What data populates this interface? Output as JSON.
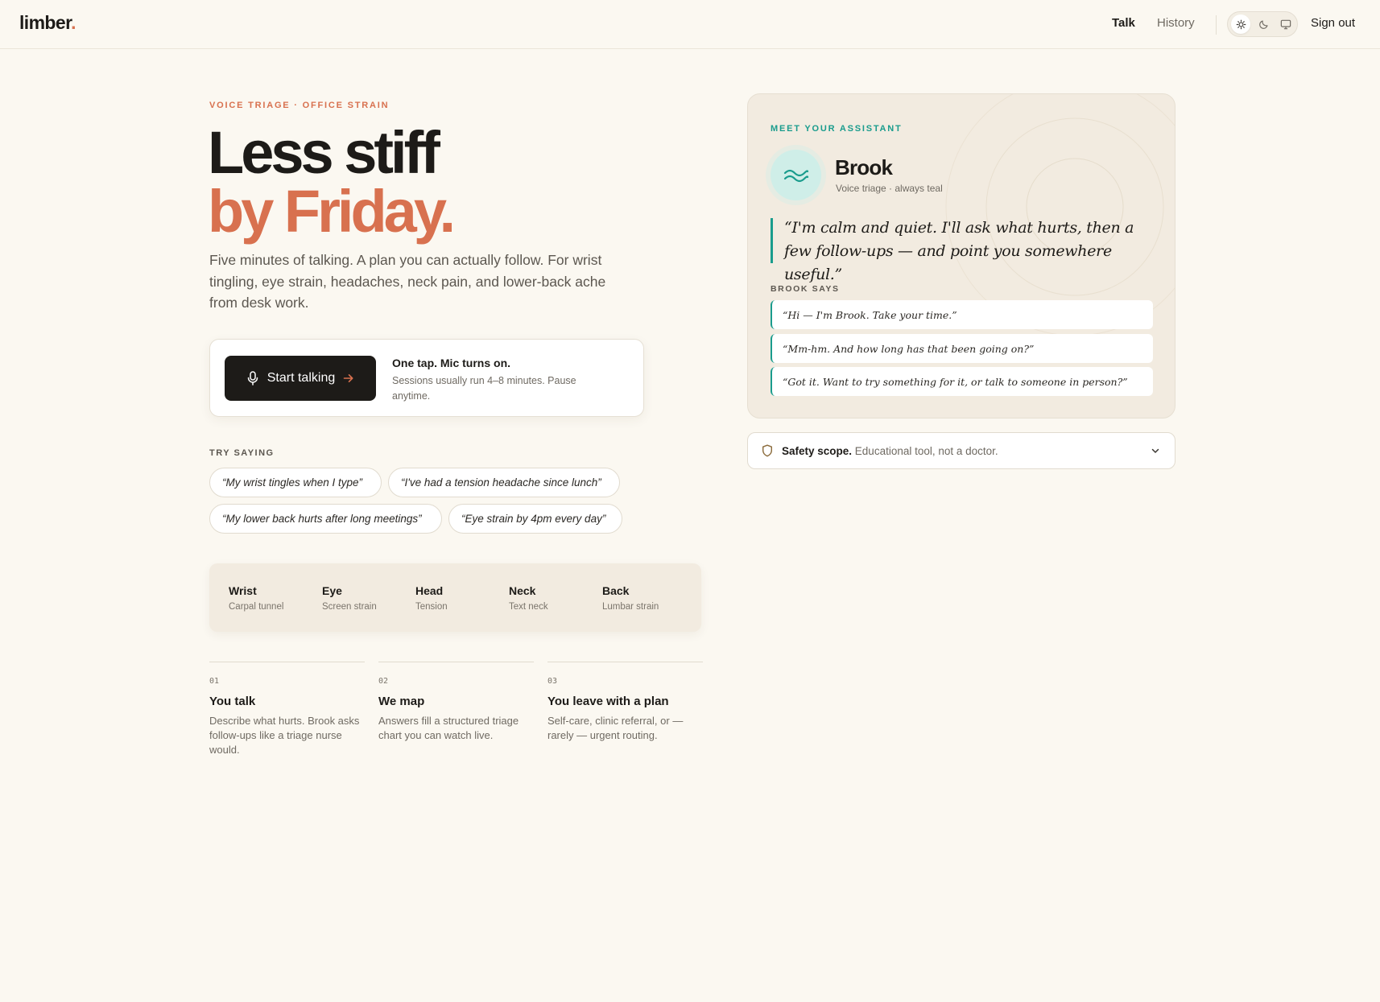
{
  "header": {
    "logo": "limber",
    "logo_dot": ".",
    "nav": {
      "talk": "Talk",
      "history": "History"
    },
    "theme_icons": [
      "sun-icon",
      "moon-icon",
      "monitor-icon"
    ],
    "theme_selected": "light",
    "sign_out": "Sign out"
  },
  "hero": {
    "eyebrow": "VOICE TRIAGE · OFFICE STRAIN",
    "title_line1": "Less stiff",
    "title_line2": "by Friday.",
    "intro": "Five minutes of talking. A plan you can actually follow. For wrist tingling, eye strain, headaches, neck pain, and lower-back ache from desk work."
  },
  "cta": {
    "button_label": "Start talking",
    "title": "One tap. Mic turns on.",
    "subtitle": "Sessions usually run 4–8 minutes. Pause anytime."
  },
  "try_saying": {
    "label": "TRY SAYING",
    "chips": [
      "“My wrist tingles when I type”",
      "“I've had a tension headache since lunch”",
      "“My lower back hurts after long meetings”",
      "“Eye strain by 4pm every day”"
    ]
  },
  "areas": [
    {
      "name": "Wrist",
      "sub": "Carpal tunnel"
    },
    {
      "name": "Eye",
      "sub": "Screen strain"
    },
    {
      "name": "Head",
      "sub": "Tension"
    },
    {
      "name": "Neck",
      "sub": "Text neck"
    },
    {
      "name": "Back",
      "sub": "Lumbar strain"
    }
  ],
  "steps": [
    {
      "num": "01",
      "title": "You talk",
      "desc": "Describe what hurts. Brook asks follow-ups like a triage nurse would."
    },
    {
      "num": "02",
      "title": "We map",
      "desc": "Answers fill a structured triage chart you can watch live."
    },
    {
      "num": "03",
      "title": "You leave with a plan",
      "desc": "Self-care, clinic referral, or — rarely — urgent routing."
    }
  ],
  "assistant": {
    "label": "MEET YOUR ASSISTANT",
    "name": "Brook",
    "subtitle": "Voice triage · always teal",
    "quote": "“I'm calm and quiet. I'll ask what hurts, then a few follow-ups — and point you somewhere useful.”",
    "says_label": "BROOK SAYS",
    "says": [
      "“Hi — I'm Brook. Take your time.”",
      "“Mm-hm. And how long has that been going on?”",
      "“Got it. Want to try something for it, or talk to someone in person?”"
    ]
  },
  "safety": {
    "bold": "Safety scope.",
    "text": " Educational tool, not a doctor."
  },
  "colors": {
    "accent": "#d8714f",
    "teal": "#1a9c8d",
    "background": "#fbf8f1",
    "ink": "#1d1b18"
  }
}
